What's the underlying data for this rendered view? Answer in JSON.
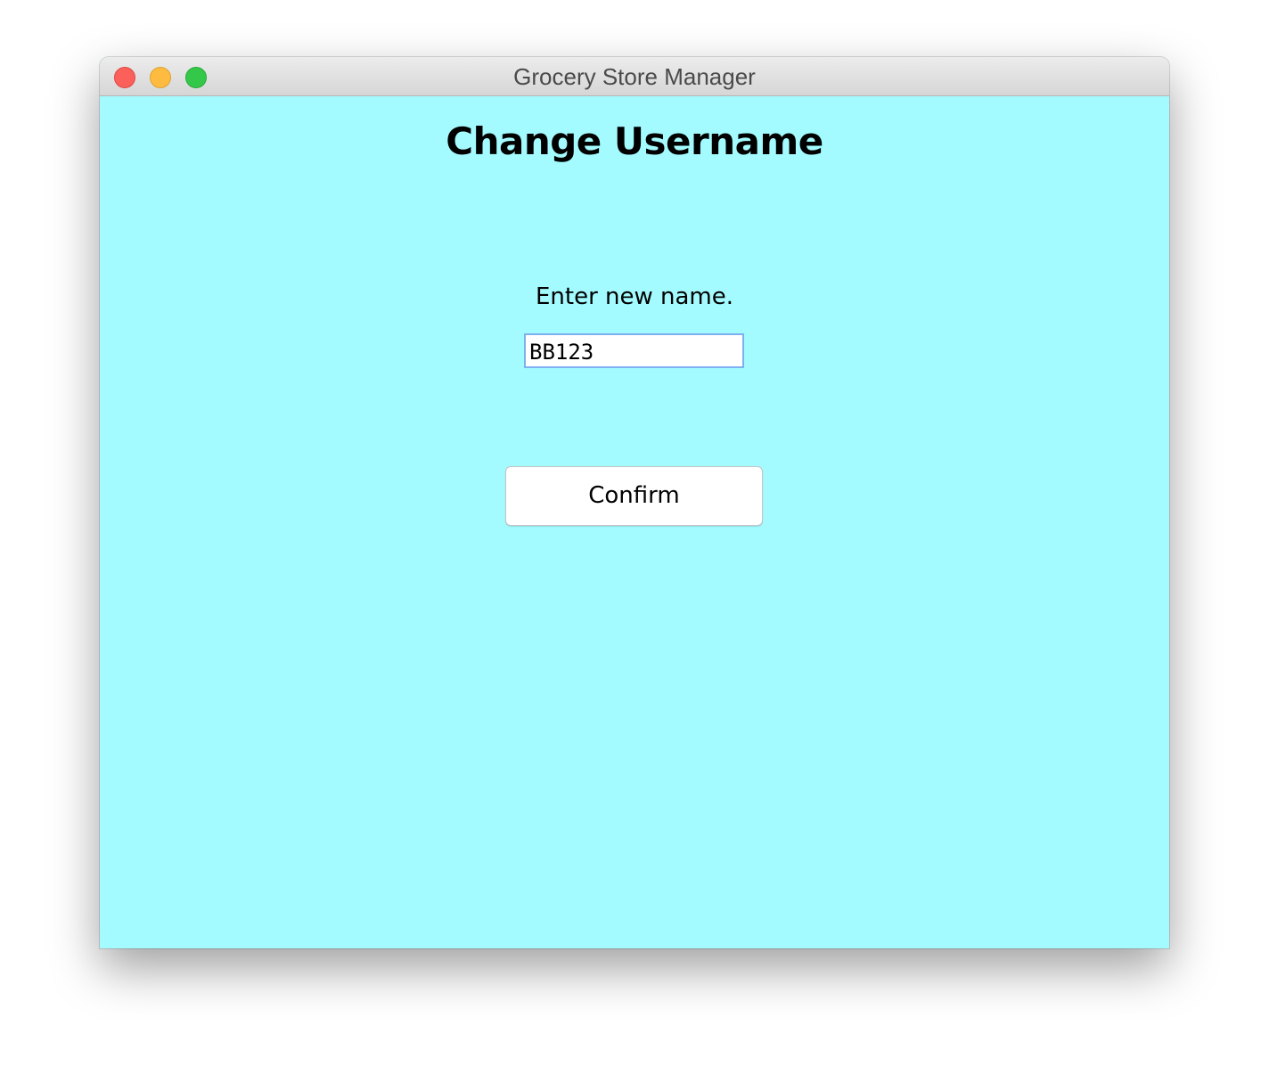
{
  "window": {
    "title": "Grocery Store Manager",
    "controls": {
      "close": "close-button",
      "minimize": "minimize-button",
      "zoom": "zoom-button"
    },
    "colors": {
      "background": "#a3fbff",
      "close": "#fc605b",
      "minimize": "#fdbc40",
      "zoom": "#34c84a",
      "input_border": "#7fb0f0"
    }
  },
  "page": {
    "heading": "Change Username",
    "prompt": "Enter new name.",
    "name_input": {
      "value": "BB123"
    },
    "confirm_label": "Confirm"
  }
}
